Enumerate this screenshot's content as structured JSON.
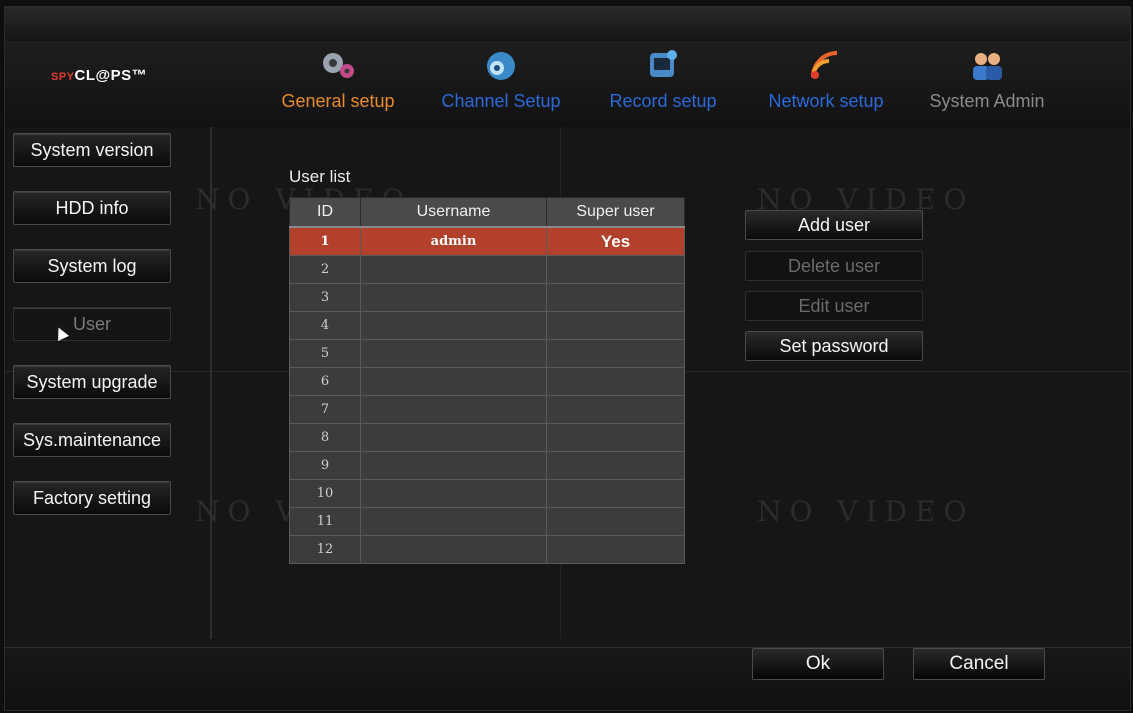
{
  "logo": {
    "prefix": "SPY",
    "text": "CL@PS",
    "suffix": "™"
  },
  "nav": [
    {
      "label": "General setup",
      "icon": "gears-icon",
      "state": "active"
    },
    {
      "label": "Channel Setup",
      "icon": "camera-icon",
      "state": "normal"
    },
    {
      "label": "Record setup",
      "icon": "monitor-record-icon",
      "state": "normal"
    },
    {
      "label": "Network setup",
      "icon": "wifi-icon",
      "state": "normal"
    },
    {
      "label": "System Admin",
      "icon": "users-icon",
      "state": "dim"
    }
  ],
  "sidebar": [
    {
      "label": "System version"
    },
    {
      "label": "HDD info"
    },
    {
      "label": "System log"
    },
    {
      "label": "User",
      "active": true
    },
    {
      "label": "System upgrade"
    },
    {
      "label": "Sys.maintenance"
    },
    {
      "label": "Factory setting"
    }
  ],
  "user_list": {
    "title": "User list",
    "headers": {
      "id": "ID",
      "username": "Username",
      "super_user": "Super user"
    },
    "rows": [
      {
        "id": "1",
        "username": "admin",
        "super_user": "Yes",
        "selected": true
      },
      {
        "id": "2",
        "username": "",
        "super_user": ""
      },
      {
        "id": "3",
        "username": "",
        "super_user": ""
      },
      {
        "id": "4",
        "username": "",
        "super_user": ""
      },
      {
        "id": "5",
        "username": "",
        "super_user": ""
      },
      {
        "id": "6",
        "username": "",
        "super_user": ""
      },
      {
        "id": "7",
        "username": "",
        "super_user": ""
      },
      {
        "id": "8",
        "username": "",
        "super_user": ""
      },
      {
        "id": "9",
        "username": "",
        "super_user": ""
      },
      {
        "id": "10",
        "username": "",
        "super_user": ""
      },
      {
        "id": "11",
        "username": "",
        "super_user": ""
      },
      {
        "id": "12",
        "username": "",
        "super_user": ""
      }
    ]
  },
  "actions": {
    "add_user": "Add user",
    "delete_user": "Delete user",
    "edit_user": "Edit user",
    "set_password": "Set password"
  },
  "background": {
    "watermark": "NO VIDEO"
  },
  "footer": {
    "ok": "Ok",
    "cancel": "Cancel"
  },
  "colors": {
    "active_tab": "#e88a2a",
    "tab": "#2a6ad8",
    "selected_row": "#b2402a"
  }
}
